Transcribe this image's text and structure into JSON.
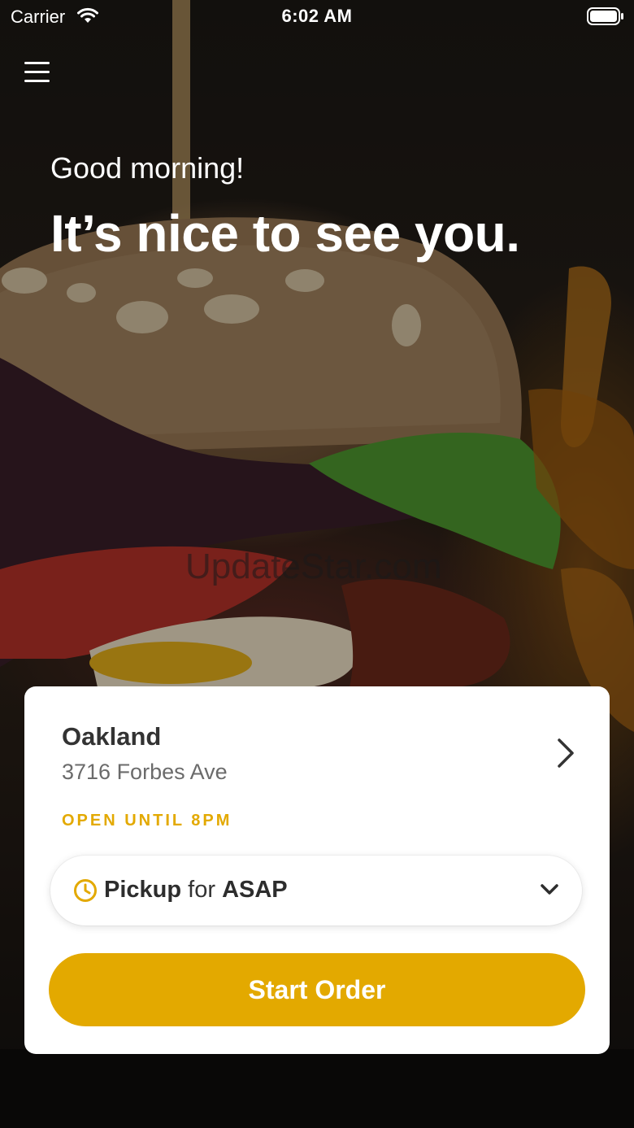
{
  "status_bar": {
    "carrier": "Carrier",
    "time": "6:02 AM",
    "icons": [
      "wifi-icon",
      "battery-icon"
    ]
  },
  "header": {
    "menu_icon": "hamburger-menu-icon"
  },
  "hero": {
    "greeting": "Good morning!",
    "headline": "It’s nice to see you.",
    "watermark": "UpdateStar.com"
  },
  "store_card": {
    "name": "Oakland",
    "address": "3716 Forbes Ave",
    "open_status": "OPEN UNTIL 8PM",
    "chevron_icon": "chevron-right-icon",
    "pickup": {
      "mode": "Pickup",
      "connector": "for",
      "time": "ASAP",
      "clock_icon": "clock-icon",
      "dropdown_icon": "chevron-down-icon"
    },
    "start_button_label": "Start Order"
  },
  "colors": {
    "accent": "#E3A900",
    "card_background": "#FFFFFF",
    "primary_text": "#333333",
    "secondary_text": "#6B6B6B"
  }
}
